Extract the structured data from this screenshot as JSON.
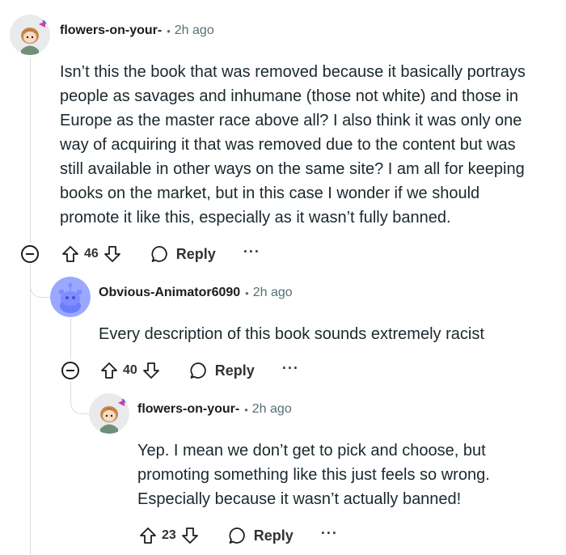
{
  "comments": [
    {
      "author": "flowers-on-your-",
      "time": "2h ago",
      "separator": "•",
      "lines": [
        "Isn’t this the book that was removed because it basically portrays",
        "people as savages and inhumane (those not white) and those in",
        "Europe as the master race above all? I also think it was only one",
        "way of acquiring it that was removed due to the content but was",
        "still available in other ways on the same site? I am all for keeping",
        "books on the market, but in this case I wonder if we should",
        "promote it like this, especially as it wasn’t fully banned."
      ],
      "votes": "46",
      "reply_label": "Reply",
      "more_label": "···"
    },
    {
      "author": "Obvious-Animator6090",
      "time": "2h ago",
      "separator": "•",
      "lines": [
        "Every description of this book sounds extremely racist"
      ],
      "votes": "40",
      "reply_label": "Reply",
      "more_label": "···"
    },
    {
      "author": "flowers-on-your-",
      "time": "2h ago",
      "separator": "•",
      "lines": [
        "Yep. I mean we don’t get to pick and choose, but",
        "promoting something like this just feels so wrong.",
        "Especially because it wasn’t actually banned!"
      ],
      "votes": "23",
      "reply_label": "Reply",
      "more_label": "···"
    }
  ],
  "icons": {
    "upvote": "upvote-icon",
    "downvote": "downvote-icon",
    "reply": "reply-bubble-icon",
    "collapse": "collapse-minus-icon",
    "avatar_snoo": "snoo-avatar",
    "avatar_custom": "custom-avatar"
  },
  "colors": {
    "text": "#1c1c1c",
    "meta": "#576f76",
    "thread": "#dcdcdc",
    "snoo_bg": "#9aa8ff"
  }
}
